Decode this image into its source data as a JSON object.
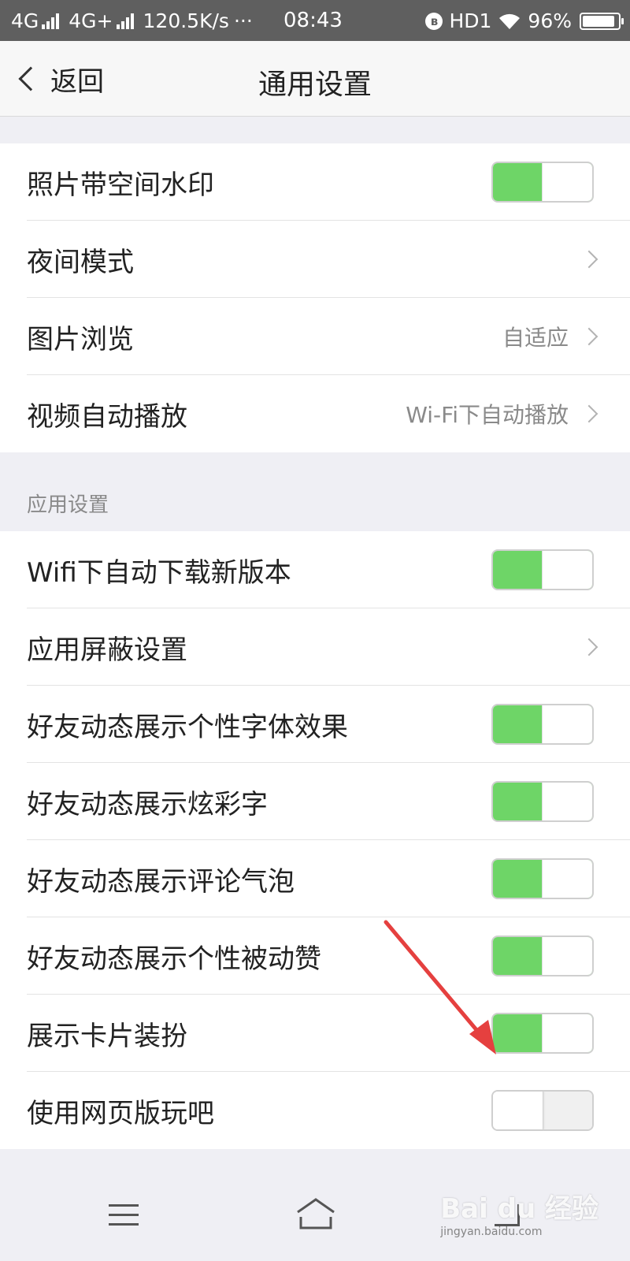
{
  "status_bar": {
    "network1": "4G",
    "network2": "4G+",
    "speed": "120.5K/s",
    "dots": "···",
    "time": "08:43",
    "bluetooth": "ʙ",
    "hd": "HD1",
    "battery": "96%"
  },
  "nav": {
    "back_label": "返回",
    "title": "通用设置"
  },
  "general": [
    {
      "label": "照片带空间水印",
      "type": "toggle",
      "on": true
    },
    {
      "label": "夜间模式",
      "type": "link",
      "value": ""
    },
    {
      "label": "图片浏览",
      "type": "link",
      "value": "自适应"
    },
    {
      "label": "视频自动播放",
      "type": "link",
      "value": "Wi-Fi下自动播放"
    }
  ],
  "app_section": {
    "header": "应用设置",
    "items": [
      {
        "label": "Wifi下自动下载新版本",
        "type": "toggle",
        "on": true
      },
      {
        "label": "应用屏蔽设置",
        "type": "link",
        "value": ""
      },
      {
        "label": "好友动态展示个性字体效果",
        "type": "toggle",
        "on": true
      },
      {
        "label": "好友动态展示炫彩字",
        "type": "toggle",
        "on": true
      },
      {
        "label": "好友动态展示评论气泡",
        "type": "toggle",
        "on": true
      },
      {
        "label": "好友动态展示个性被动赞",
        "type": "toggle",
        "on": true
      },
      {
        "label": "展示卡片装扮",
        "type": "toggle",
        "on": true
      },
      {
        "label": "使用网页版玩吧",
        "type": "toggle",
        "on": false
      }
    ]
  },
  "watermark": {
    "brand": "Bai du 经验",
    "url": "jingyan.baidu.com"
  },
  "colors": {
    "toggle_on": "#6ed567",
    "annotation_arrow": "#e5403f"
  }
}
